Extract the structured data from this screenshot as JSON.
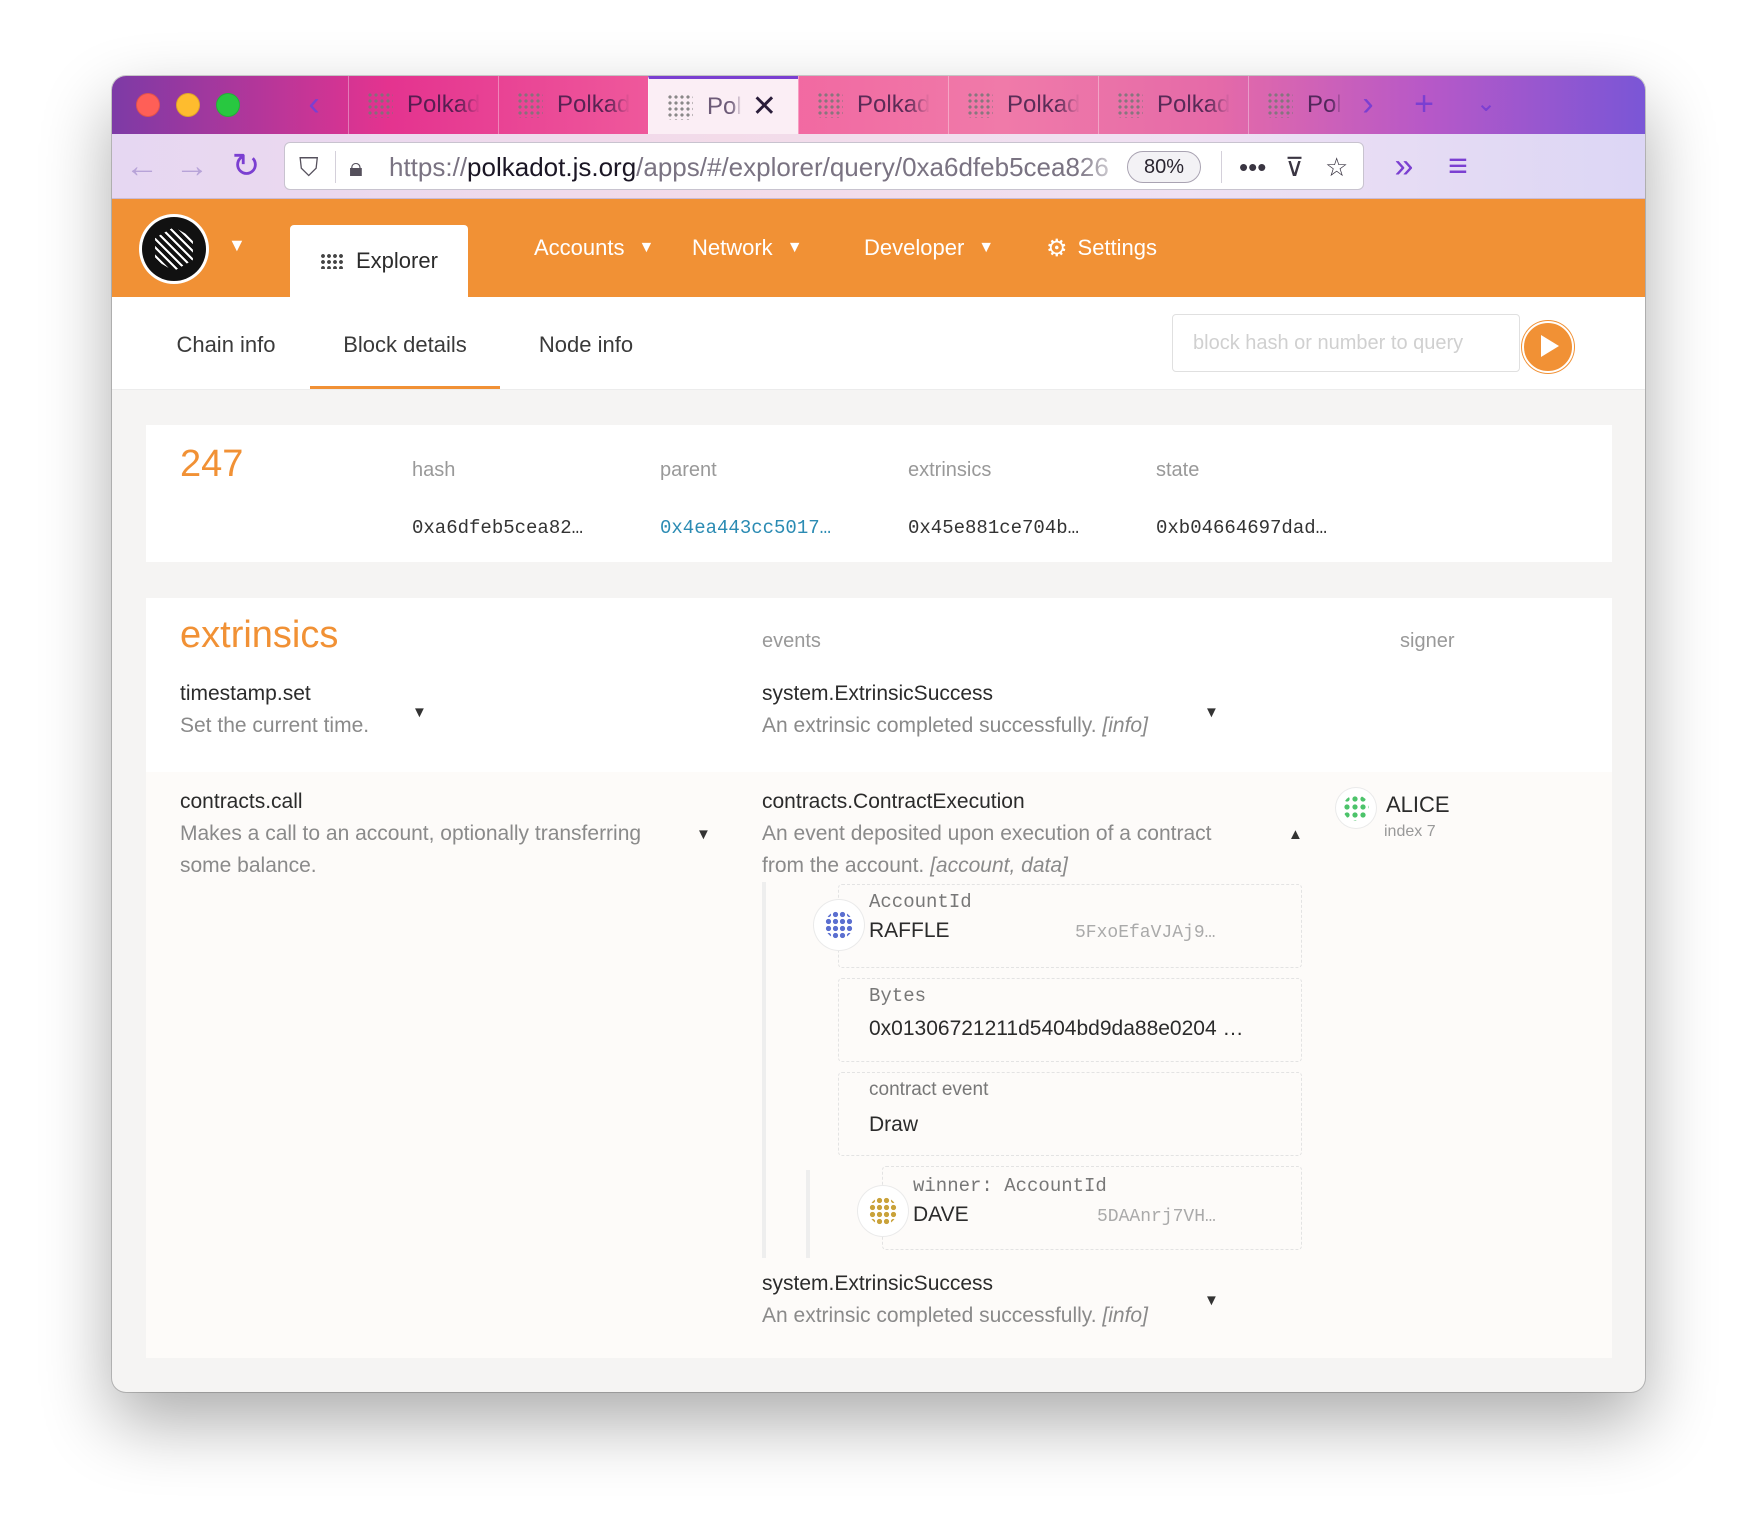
{
  "browser": {
    "tabs": [
      {
        "label": "Polkad"
      },
      {
        "label": "Polkad"
      },
      {
        "label": "Pol"
      },
      {
        "label": "Polkad"
      },
      {
        "label": "Polkad"
      },
      {
        "label": "Polkad"
      },
      {
        "label": "Pol"
      }
    ],
    "active_tab_index": 2,
    "url_prefix": "https://",
    "url_host": "polkadot.js.org",
    "url_path": "/apps/#/explorer/query/0xa6dfeb5cea826",
    "zoom": "80%"
  },
  "nav": {
    "explorer": "Explorer",
    "accounts": "Accounts",
    "network": "Network",
    "developer": "Developer",
    "settings": "Settings"
  },
  "subnav": {
    "chain_info": "Chain info",
    "block_details": "Block details",
    "node_info": "Node info",
    "query_placeholder": "block hash or number to query"
  },
  "block": {
    "number": "247",
    "labels": {
      "hash": "hash",
      "parent": "parent",
      "extrinsics": "extrinsics",
      "state": "state"
    },
    "hash": "0xa6dfeb5cea82…",
    "parent": "0x4ea443cc5017…",
    "extrinsics_root": "0x45e881ce704b…",
    "state_root": "0xb04664697dad…"
  },
  "extrinsics": {
    "title": "extrinsics",
    "events_header": "events",
    "signer_header": "signer",
    "rows": [
      {
        "method": "timestamp.set",
        "doc": "Set the current time.",
        "event": "system.ExtrinsicSuccess",
        "event_doc": "An extrinsic completed successfully.",
        "event_doc_args": "[info]"
      },
      {
        "method": "contracts.call",
        "doc": "Makes a call to an account, optionally transferring some balance.",
        "event": "contracts.ContractExecution",
        "event_doc": "An event deposited upon execution of a contract from the account.",
        "event_doc_args": "[account, data]",
        "signer_name": "ALICE",
        "signer_index": "index 7",
        "params": {
          "account_label": "AccountId",
          "account_name": "RAFFLE",
          "account_addr": "5FxoEfaVJAj9…",
          "bytes_label": "Bytes",
          "bytes_value": "0x01306721211d5404bd9da88e0204 …",
          "event_label": "contract event",
          "event_value": "Draw",
          "winner_label": "winner: AccountId",
          "winner_name": "DAVE",
          "winner_addr": "5DAAnrj7VH…"
        },
        "event2": "system.ExtrinsicSuccess",
        "event2_doc": "An extrinsic completed successfully.",
        "event2_doc_args": "[info]"
      }
    ]
  },
  "colors": {
    "accent": "#f19135",
    "link": "#2b8bb3"
  }
}
